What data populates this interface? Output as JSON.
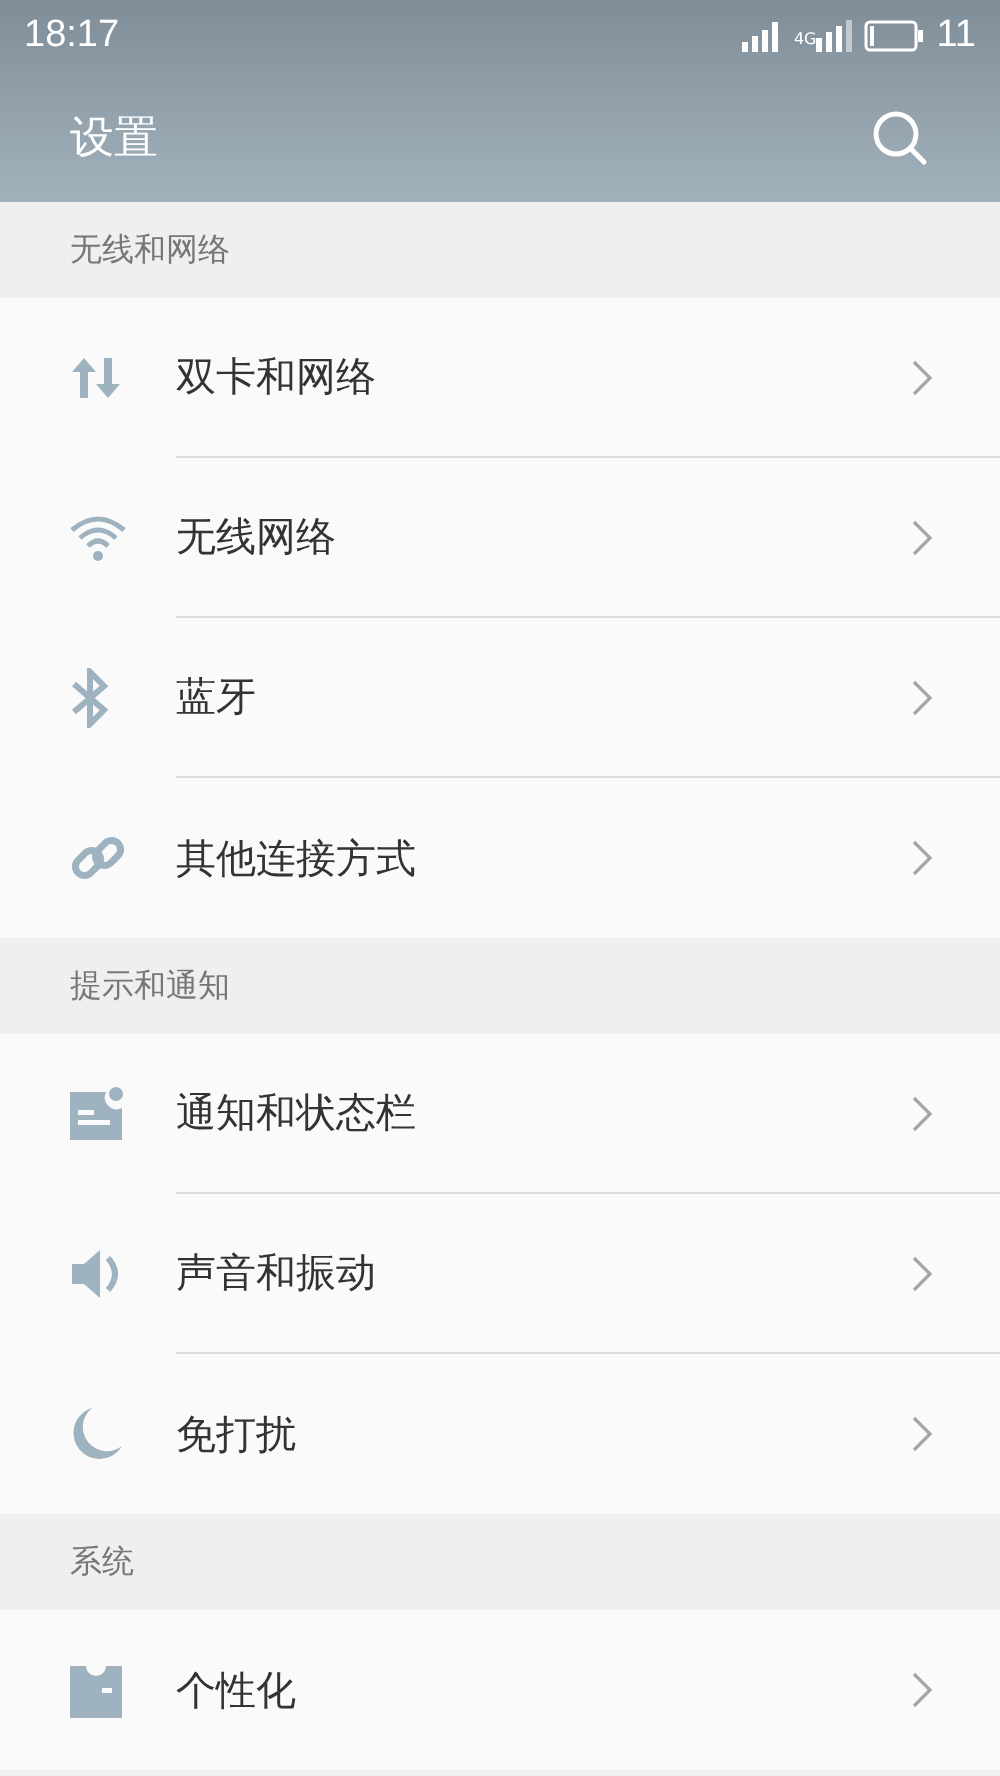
{
  "status_bar": {
    "time": "18:17",
    "network": "4G",
    "battery": "11"
  },
  "app_bar": {
    "title": "设置"
  },
  "sections": [
    {
      "title": "无线和网络",
      "items": [
        {
          "label": "双卡和网络"
        },
        {
          "label": "无线网络"
        },
        {
          "label": "蓝牙"
        },
        {
          "label": "其他连接方式"
        }
      ]
    },
    {
      "title": "提示和通知",
      "items": [
        {
          "label": "通知和状态栏"
        },
        {
          "label": "声音和振动"
        },
        {
          "label": "免打扰"
        }
      ]
    },
    {
      "title": "系统",
      "items": [
        {
          "label": "个性化"
        }
      ]
    }
  ]
}
